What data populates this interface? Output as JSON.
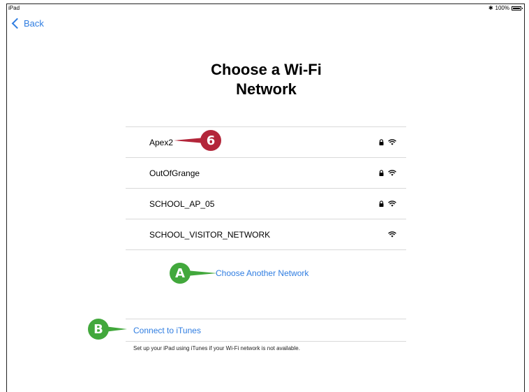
{
  "status_bar": {
    "device": "iPad",
    "bluetooth_icon": "bluetooth-icon",
    "battery": "100%",
    "battery_level": 1.0
  },
  "nav": {
    "back_label": "Back"
  },
  "title": {
    "line1": "Choose a Wi-Fi",
    "line2": "Network"
  },
  "networks": [
    {
      "name": "Apex2",
      "secured": true
    },
    {
      "name": "OutOfGrange",
      "secured": true
    },
    {
      "name": "SCHOOL_AP_05",
      "secured": true
    },
    {
      "name": "SCHOOL_VISITOR_NETWORK",
      "secured": false
    }
  ],
  "choose_another_label": "Choose Another Network",
  "itunes": {
    "link_label": "Connect to iTunes",
    "caption": "Set up your iPad using iTunes if your Wi-Fi network is not available."
  },
  "callouts": {
    "c6": "6",
    "a": "A",
    "b": "B"
  },
  "colors": {
    "link_blue": "#2f7de1",
    "callout_red": "#b3263a",
    "callout_green": "#42a83c"
  }
}
